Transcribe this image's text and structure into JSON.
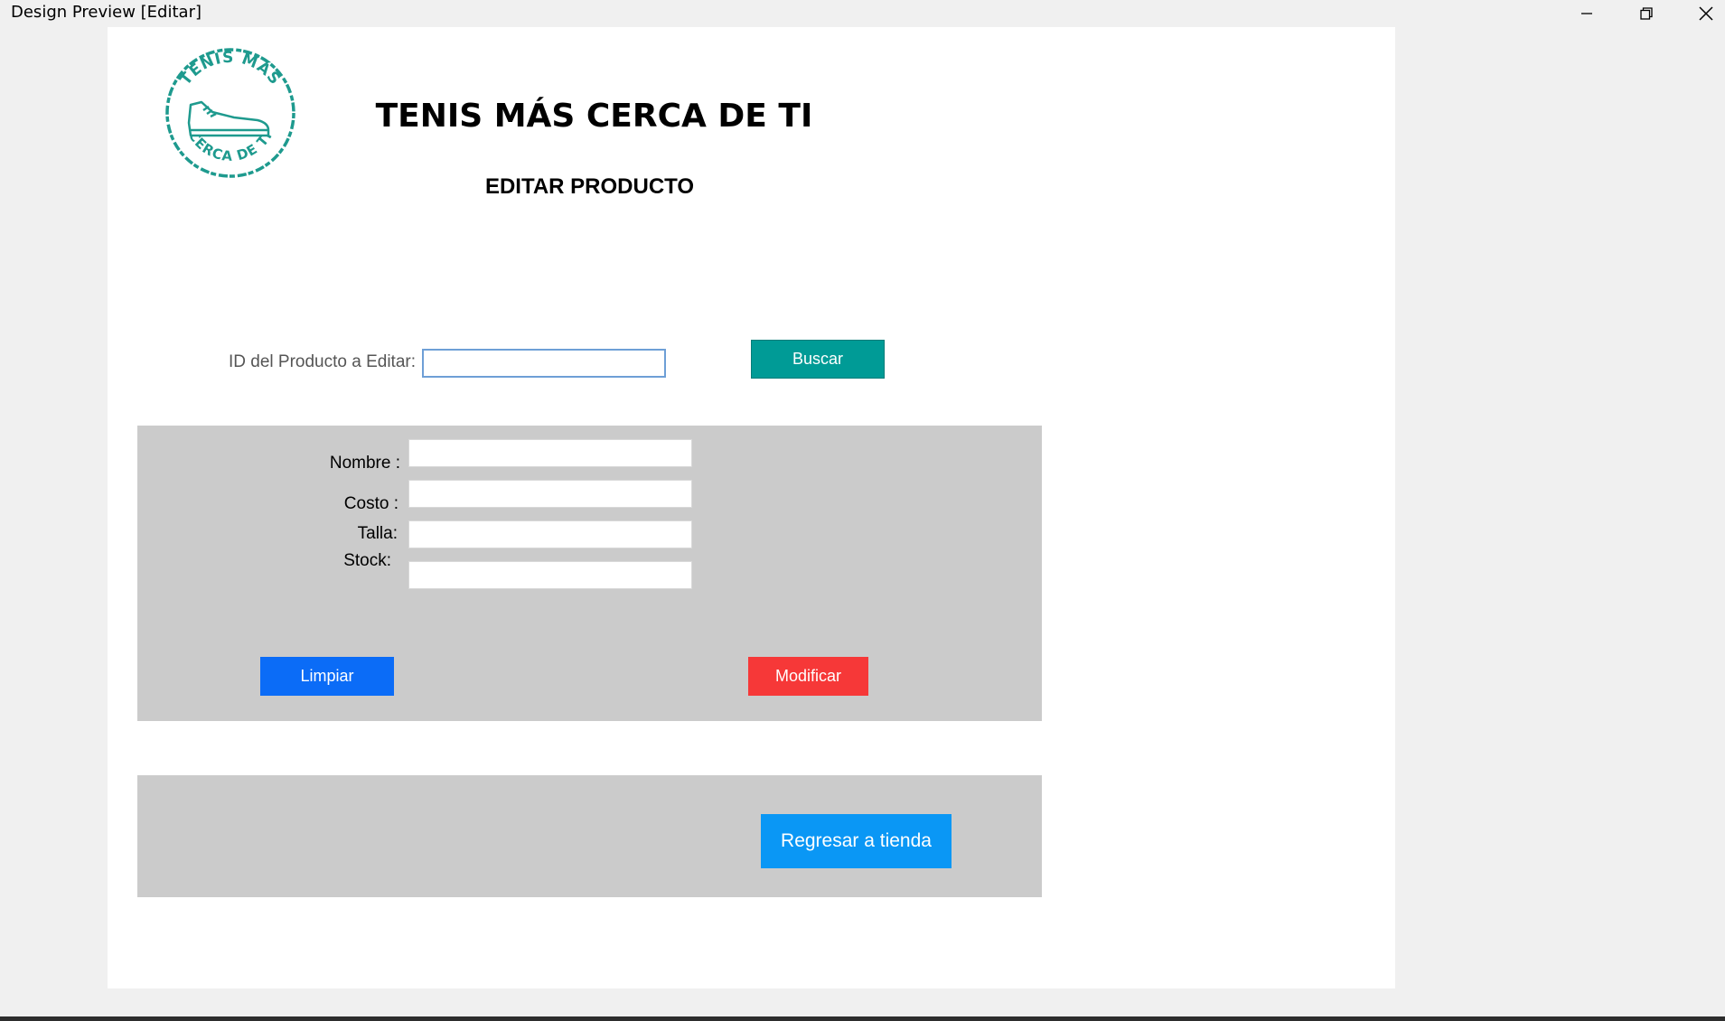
{
  "window": {
    "title": "Design Preview [Editar]",
    "controls": [
      "minimize-icon",
      "restore-icon",
      "close-icon"
    ]
  },
  "header": {
    "title": "TENIS MÁS CERCA DE TI",
    "subtitle": "EDITAR PRODUCTO",
    "logo": {
      "top_text": "TENIS MÁS",
      "bottom_text": "CERCA DE TI",
      "icon": "sneaker-icon",
      "color": "#1e9a8e"
    }
  },
  "search": {
    "label": "ID del Producto a Editar:",
    "value": "",
    "button_label": "Buscar"
  },
  "form": {
    "fields": [
      {
        "label": "Nombre :",
        "value": ""
      },
      {
        "label": "Costo :",
        "value": ""
      },
      {
        "label": "Talla:",
        "value": ""
      },
      {
        "label": "Stock:",
        "value": ""
      }
    ],
    "clear_label": "Limpiar",
    "modify_label": "Modificar"
  },
  "footer": {
    "back_label": "Regresar a tienda"
  },
  "colors": {
    "buscar": "#009b96",
    "limpiar": "#0b6cf7",
    "modificar": "#f63838",
    "regresar": "#0a97f5",
    "panel_gray": "#cbcbcb"
  }
}
